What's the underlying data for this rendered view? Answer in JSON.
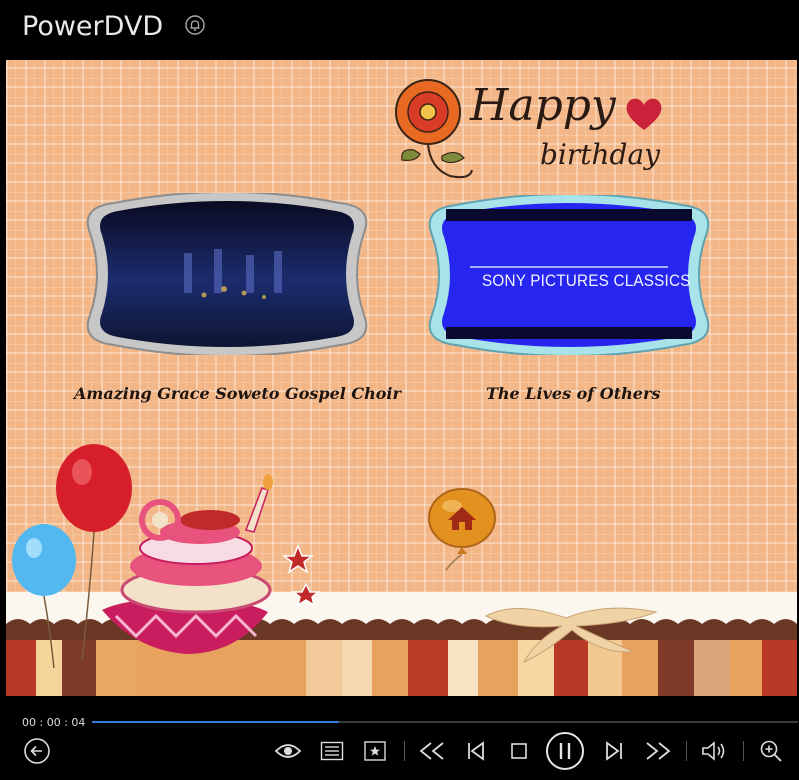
{
  "app": {
    "title": "PowerDVD"
  },
  "disc_menu": {
    "logo_line1": "Happy",
    "logo_line2": "birthday",
    "chapters": [
      {
        "label": "Amazing Grace Soweto Gospel Choir"
      },
      {
        "label": "The Lives of Others",
        "thumbnail_text": "SONY PICTURES CLASSICS"
      }
    ]
  },
  "player": {
    "time": "00 : 00 : 04",
    "progress": 0.35,
    "accent": "#2f7bd6",
    "icons": [
      "back-arrow-icon",
      "eye-icon",
      "list-icon",
      "favorite-star-icon",
      "rewind-icon",
      "previous-chapter-icon",
      "stop-icon",
      "pause-icon",
      "next-chapter-icon",
      "fast-forward-icon",
      "volume-icon",
      "zoom-in-icon"
    ]
  }
}
